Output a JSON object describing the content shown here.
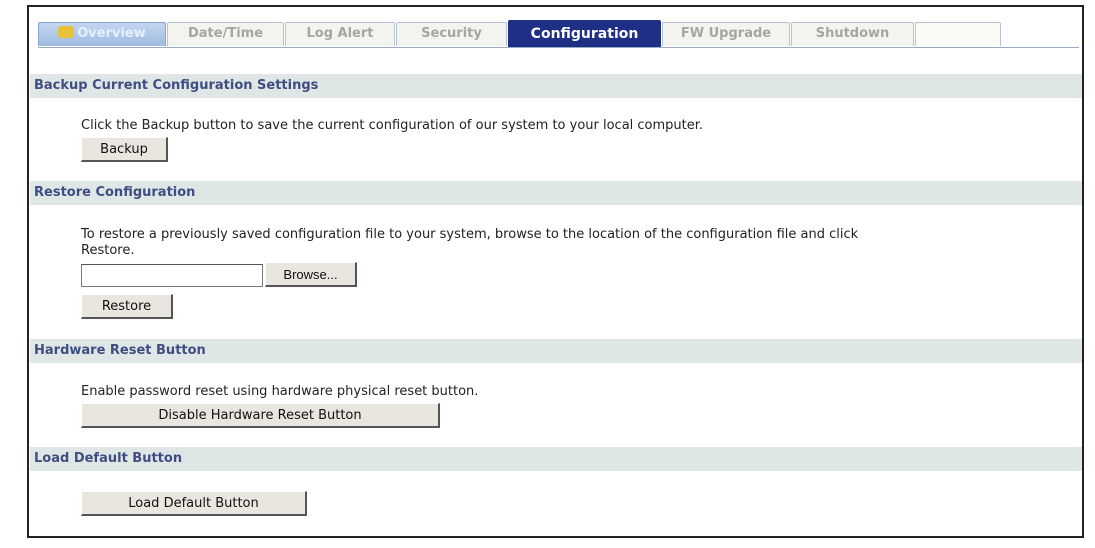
{
  "tabs": [
    {
      "label": "Overview",
      "icon": "chat-bubble-icon"
    },
    {
      "label": "Date/Time"
    },
    {
      "label": "Log Alert"
    },
    {
      "label": "Security"
    },
    {
      "label": "Configuration"
    },
    {
      "label": "FW Upgrade"
    },
    {
      "label": "Shutdown"
    }
  ],
  "active_tab": "Configuration",
  "sections": {
    "backup": {
      "title": "Backup Current Configuration Settings",
      "description": "Click the Backup button to save the current configuration of our system to your local computer.",
      "button": "Backup"
    },
    "restore": {
      "title": "Restore Configuration",
      "description_line1": "To restore a previously saved configuration file to your system, browse to the location of the configuration file and click",
      "description_line2": "Restore.",
      "file_value": "",
      "browse_button": "Browse...",
      "button": "Restore"
    },
    "hardware_reset": {
      "title": "Hardware Reset Button",
      "description": "Enable password reset using hardware physical reset button.",
      "button": "Disable Hardware Reset Button"
    },
    "load_default": {
      "title": "Load Default Button",
      "button": "Load Default Button"
    }
  },
  "colors": {
    "active_tab_bg": "#1f2f85",
    "section_header_bg": "#dfe7e6",
    "section_header_text": "#3e4e82"
  }
}
